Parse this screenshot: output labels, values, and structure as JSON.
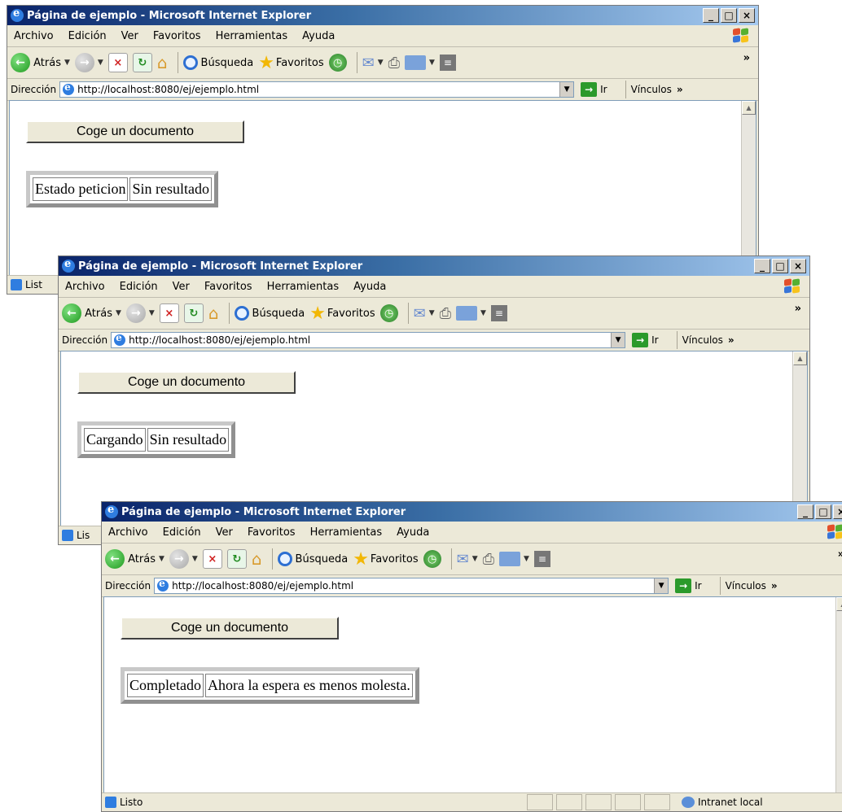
{
  "windows": [
    {
      "title": "Página de ejemplo - Microsoft Internet Explorer",
      "address": "http://localhost:8080/ej/ejemplo.html",
      "button_label": "Coge un documento",
      "cells": [
        "Estado peticion",
        "Sin resultado"
      ],
      "status": "List"
    },
    {
      "title": "Página de ejemplo - Microsoft Internet Explorer",
      "address": "http://localhost:8080/ej/ejemplo.html",
      "button_label": "Coge un documento",
      "cells": [
        "Cargando",
        "Sin resultado"
      ],
      "status": "Lis"
    },
    {
      "title": "Página de ejemplo - Microsoft Internet Explorer",
      "address": "http://localhost:8080/ej/ejemplo.html",
      "button_label": "Coge un documento",
      "cells": [
        "Completado",
        "Ahora la espera es menos molesta."
      ],
      "status": "Listo",
      "zone": "Intranet local"
    }
  ],
  "menu": [
    "Archivo",
    "Edición",
    "Ver",
    "Favoritos",
    "Herramientas",
    "Ayuda"
  ],
  "toolbar": {
    "back": "Atrás",
    "search": "Búsqueda",
    "favorites": "Favoritos"
  },
  "address_label": "Dirección",
  "go_label": "Ir",
  "links_label": "Vínculos",
  "colors": {
    "titlebar": "#0a246a",
    "chrome": "#ece9d8"
  }
}
